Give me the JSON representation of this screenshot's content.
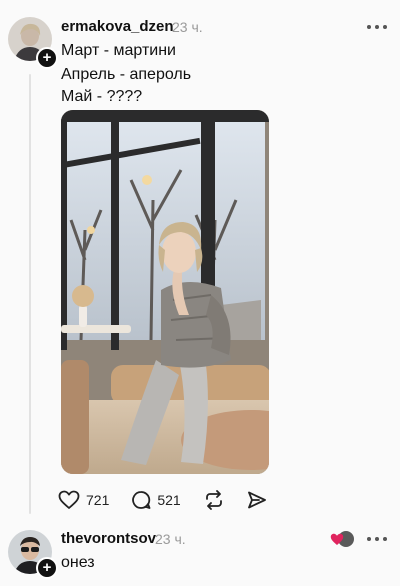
{
  "post": {
    "author": {
      "username": "ermakova_dzen",
      "time": "23 ч.",
      "follow_icon": "plus-icon"
    },
    "text_lines": [
      "Март - мартини",
      "Апрель - апероль",
      "Май - ????"
    ],
    "image": {
      "alt": "Woman seated on a cafe windowsill bench"
    },
    "actions": {
      "likes": "721",
      "comments": "521",
      "repost_icon": "repost-icon",
      "share_icon": "share-icon"
    },
    "menu_icon": "more-icon"
  },
  "reply": {
    "author": {
      "username": "thevorontsov",
      "time": "23 ч.",
      "follow_icon": "plus-icon"
    },
    "text": "онез",
    "liked_by_author_icon": "heart-badge-icon",
    "menu_icon": "more-icon"
  },
  "colors": {
    "background": "#fafafa",
    "text": "#111111",
    "secondary_text": "#9a9a9a",
    "heart_red": "#e0245e"
  }
}
